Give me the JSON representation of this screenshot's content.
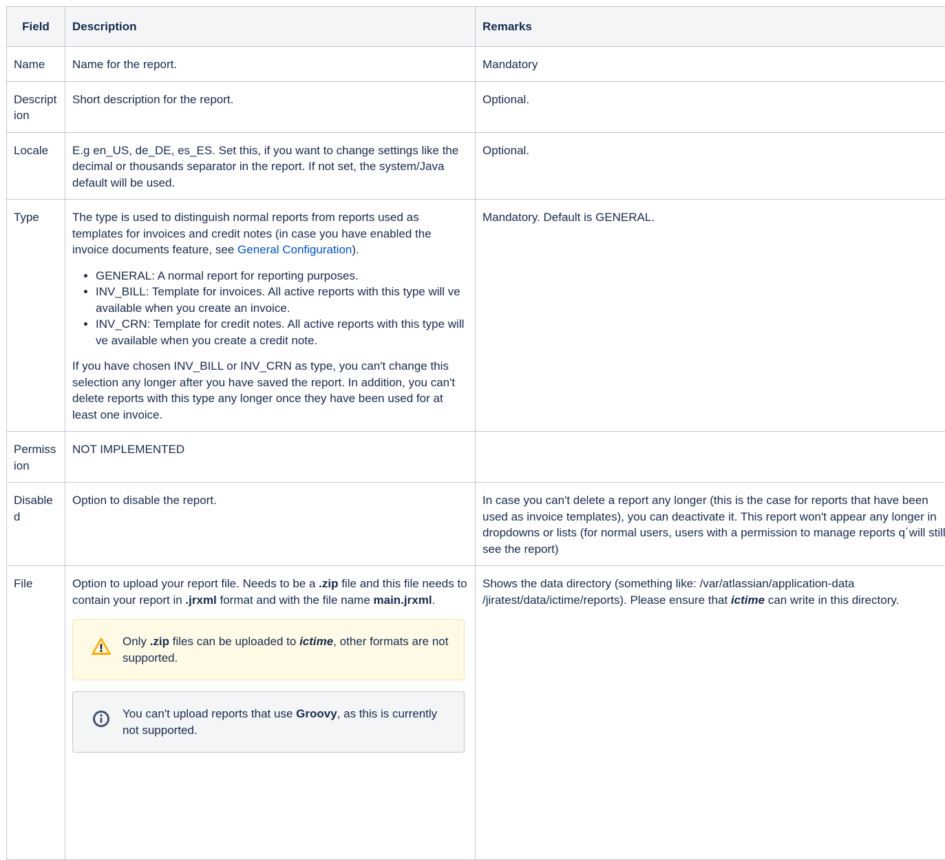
{
  "headers": {
    "field": "Field",
    "description": "Description",
    "remarks": "Remarks"
  },
  "rows": {
    "name": {
      "field": "Name",
      "description": "Name for the report.",
      "remarks": "Mandatory"
    },
    "description": {
      "field": "Description",
      "description": "Short description for the report.",
      "remarks": "Optional."
    },
    "locale": {
      "field": "Locale",
      "description": "E.g en_US, de_DE, es_ES. Set this, if you want to change settings like the decimal or thousands separator in the report. If not set, the system/Java default will be used.",
      "remarks": "Optional."
    },
    "type": {
      "field": "Type",
      "desc_intro": "The type is used to distinguish normal reports from reports used as templates for invoices and credit notes (in case you have enabled the invoice documents feature, see ",
      "desc_link": "General Configuration",
      "desc_intro_end": ").",
      "bullets": [
        "GENERAL: A normal report for reporting purposes.",
        "INV_BILL: Template for invoices. All active reports with this type will ve available when you create an invoice.",
        "INV_CRN: Template for credit notes. All active reports with this type will ve available when you create a credit note."
      ],
      "desc_outro": "If you have chosen INV_BILL or INV_CRN as type, you can't change this selection any longer after you have saved the report. In addition, you can't delete reports with this type any longer once they have been used for at least one invoice.",
      "remarks": "Mandatory. Default is GENERAL."
    },
    "permission": {
      "field": "Permission",
      "description": "NOT IMPLEMENTED",
      "remarks": ""
    },
    "disabled": {
      "field": "Disabled",
      "description": "Option to disable the report.",
      "remarks": "In case you can't delete a report any longer (this is the case for reports that have been used as invoice templates), you can deactivate it. This report won't appear any longer in dropdowns or lists (for normal users, users with a permission to manage reports q´will still see the report)"
    },
    "file": {
      "field": "File",
      "d1": "Option to upload your report file. Needs to be a ",
      "d1_zip": ".zip",
      "d2": " file and this file needs to contain your report in ",
      "d2_jrxml": ".jrxml",
      "d3": " format and with the file name ",
      "d3_main": "main.jrxml",
      "d4": ".",
      "warn_a": "Only ",
      "warn_zip": ".zip",
      "warn_b": " files can be uploaded to ",
      "warn_brand": "ictime",
      "warn_c": ", other formats are not supported.",
      "info_a": "You can't upload reports that use ",
      "info_groovy": "Groovy",
      "info_b": ", as this is currently not supported.",
      "remarks_a": "Shows the data directory (something like: /var/atlassian/application-data /jiratest/data/ictime/reports). Please ensure that ",
      "remarks_brand": "ictime",
      "remarks_b": " can write in this directory."
    }
  },
  "icons": {
    "warning": "warning-icon",
    "info": "info-icon"
  },
  "colors": {
    "link": "#0052cc",
    "warning_icon": "#ffab00",
    "info_icon": "#42526e"
  }
}
